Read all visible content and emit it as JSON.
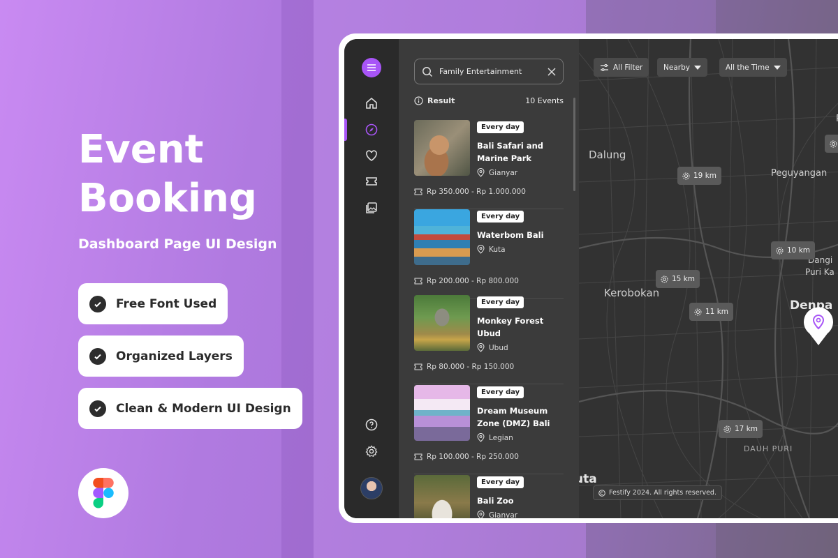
{
  "hero": {
    "title_line1": "Event",
    "title_line2": "Booking",
    "subtitle": "Dashboard Page UI Design",
    "features": [
      "Free Font Used",
      "Organized Layers",
      "Clean & Modern UI Design"
    ]
  },
  "search": {
    "value": "Family Entertainment"
  },
  "results": {
    "label": "Result",
    "count": "10 Events"
  },
  "events": [
    {
      "badge": "Every day",
      "name": "Bali Safari and Marine Park",
      "location": "Gianyar",
      "price": "Rp 350.000 - Rp 1.000.000"
    },
    {
      "badge": "Every day",
      "name": "Waterbom Bali",
      "location": "Kuta",
      "price": "Rp 200.000 - Rp 800.000"
    },
    {
      "badge": "Every day",
      "name": "Monkey Forest Ubud",
      "location": "Ubud",
      "price": "Rp 80.000 - Rp 150.000"
    },
    {
      "badge": "Every day",
      "name": "Dream Museum Zone (DMZ) Bali",
      "location": "Legian",
      "price": "Rp 100.000 - Rp 250.000"
    },
    {
      "badge": "Every day",
      "name": "Bali Zoo",
      "location": "Gianyar",
      "price": ""
    }
  ],
  "filters": {
    "all_filter": "All Filter",
    "nearby": "Nearby",
    "time": "All the Time"
  },
  "map": {
    "places": [
      "Dalung",
      "Peguyangan",
      "Kerobokan",
      "Denpa",
      "Dangi",
      "Puri Ka",
      "DAUH PURI",
      "uta",
      "Pe"
    ],
    "distances": [
      "19 km",
      "10 km",
      "15 km",
      "11 km",
      "17 km"
    ],
    "footer": "Festify 2024. All rights reserved."
  },
  "colors": {
    "accent": "#a855f7",
    "panel": "#3b3b3b",
    "rail": "#2a2a2a",
    "map": "#323232"
  }
}
